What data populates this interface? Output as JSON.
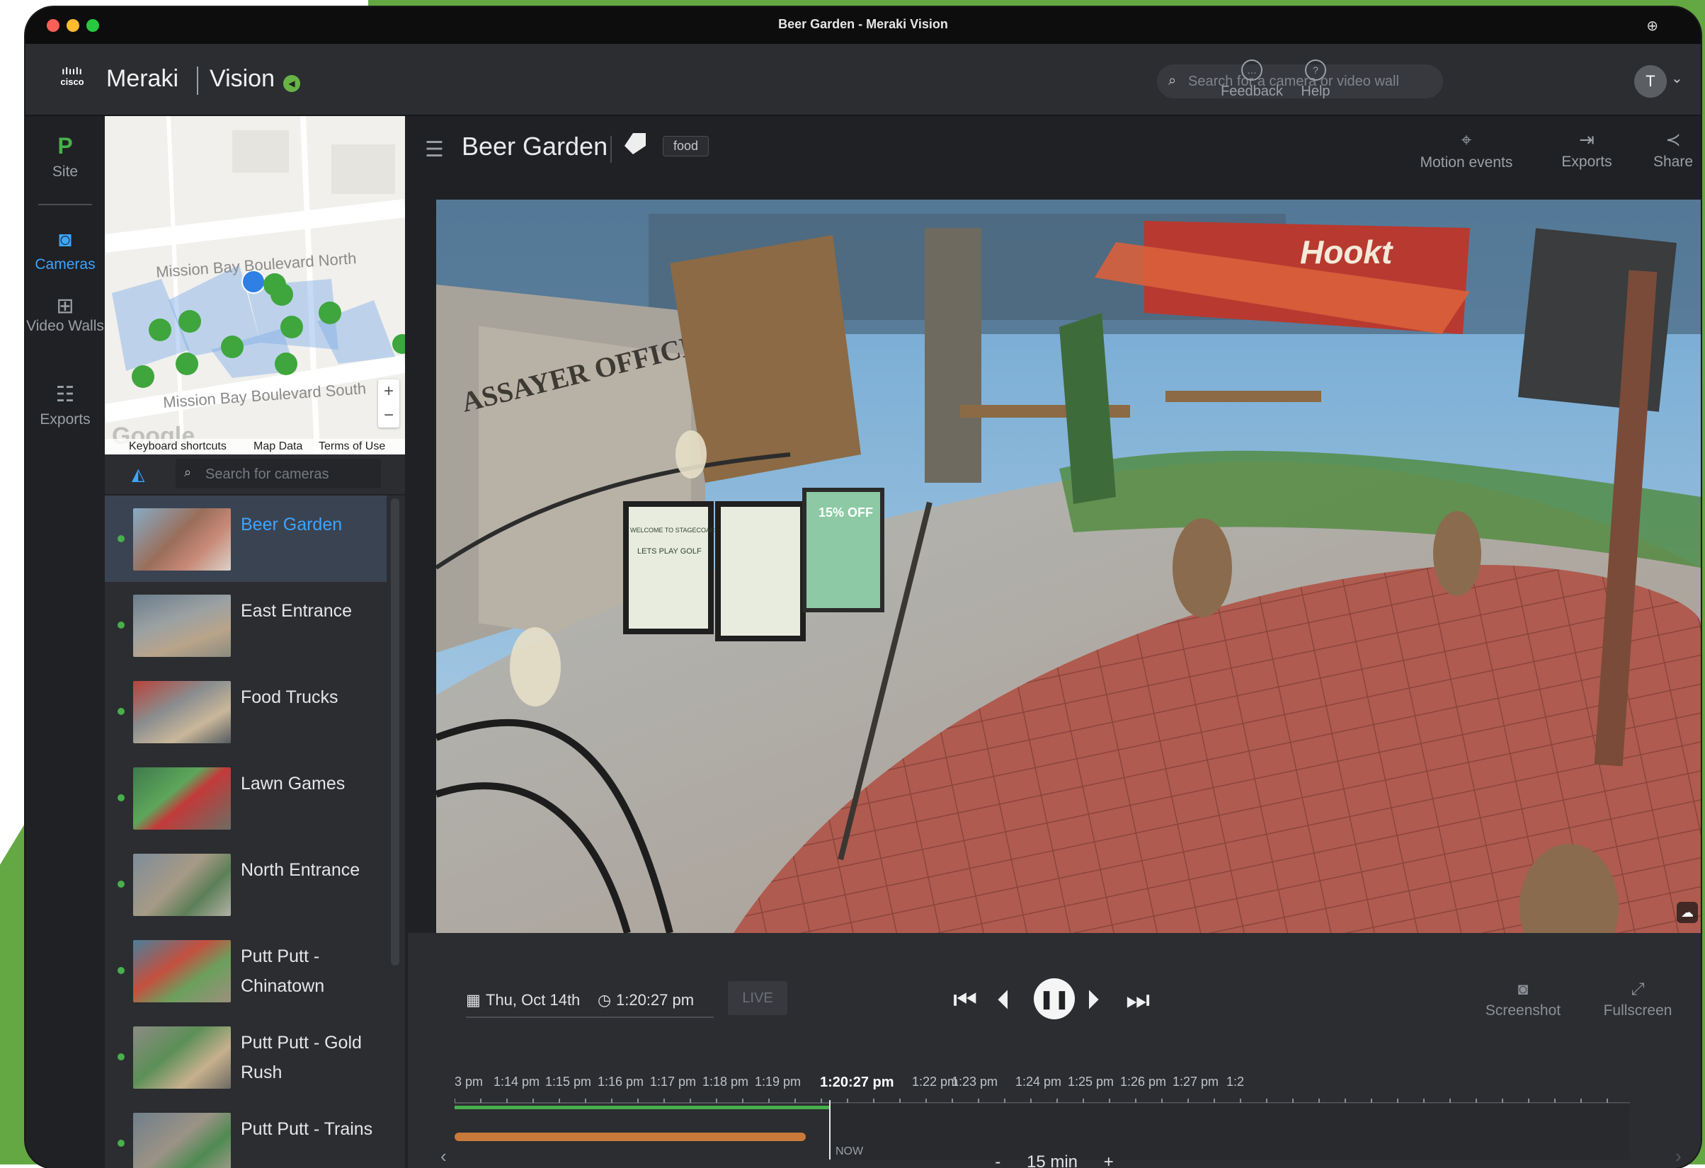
{
  "window": {
    "title": "Beer Garden - Meraki Vision"
  },
  "brand": {
    "cisco": "cisco",
    "meraki": "Meraki",
    "vision": "Vision"
  },
  "topbar": {
    "search_placeholder": "Search for a camera or video wall",
    "feedback": "Feedback",
    "help": "Help",
    "avatar_initial": "T"
  },
  "leftnav": {
    "site_badge": "P",
    "site": "Site",
    "cameras": "Cameras",
    "video_walls": "Video Walls",
    "exports": "Exports"
  },
  "map": {
    "road_north": "Mission Bay Boulevard North",
    "road_south": "Mission Bay Boulevard South",
    "attribution": [
      "Keyboard shortcuts",
      "Map Data",
      "Terms of Use"
    ],
    "zoom_in": "+",
    "zoom_out": "−"
  },
  "camera_search": {
    "placeholder": "Search for cameras"
  },
  "cameras": [
    {
      "name": "Beer Garden",
      "status": "online",
      "active": true
    },
    {
      "name": "East Entrance",
      "status": "online",
      "active": false
    },
    {
      "name": "Food Trucks",
      "status": "online",
      "active": false
    },
    {
      "name": "Lawn Games",
      "status": "online",
      "active": false
    },
    {
      "name": "North Entrance",
      "status": "online",
      "active": false
    },
    {
      "name": "Putt Putt - Chinatown",
      "status": "online",
      "active": false
    },
    {
      "name": "Putt Putt - Gold Rush",
      "status": "online",
      "active": false
    },
    {
      "name": "Putt Putt - Trains",
      "status": "online",
      "active": false
    }
  ],
  "camera_header": {
    "title": "Beer Garden",
    "tag": "food",
    "motion_events": "Motion events",
    "exports": "Exports",
    "share": "Share"
  },
  "video": {
    "signs": [
      "ASSAYER OFFICE",
      "Hookt",
      "WELCOME TO STAGECOACH GREENS",
      "LETS PLAY GOLF",
      "15% OFF"
    ]
  },
  "playback": {
    "date": "Thu, Oct 14th",
    "time": "1:20:27 pm",
    "live": "LIVE",
    "screenshot": "Screenshot",
    "fullscreen": "Fullscreen",
    "now_label": "NOW",
    "zoom_minus": "-",
    "zoom_value": "15 min",
    "zoom_plus": "+",
    "timeline_labels": [
      "3 pm",
      "1:14 pm",
      "1:15 pm",
      "1:16 pm",
      "1:17 pm",
      "1:18 pm",
      "1:19 pm",
      "1:20:27 pm",
      "1:22 pm",
      "1:23 pm",
      "1:24 pm",
      "1:25 pm",
      "1:26 pm",
      "1:27 pm",
      "1:2"
    ],
    "colors": {
      "recorded": "#47b04b",
      "motion": "#c9793a",
      "accent": "#3da4ff"
    }
  }
}
